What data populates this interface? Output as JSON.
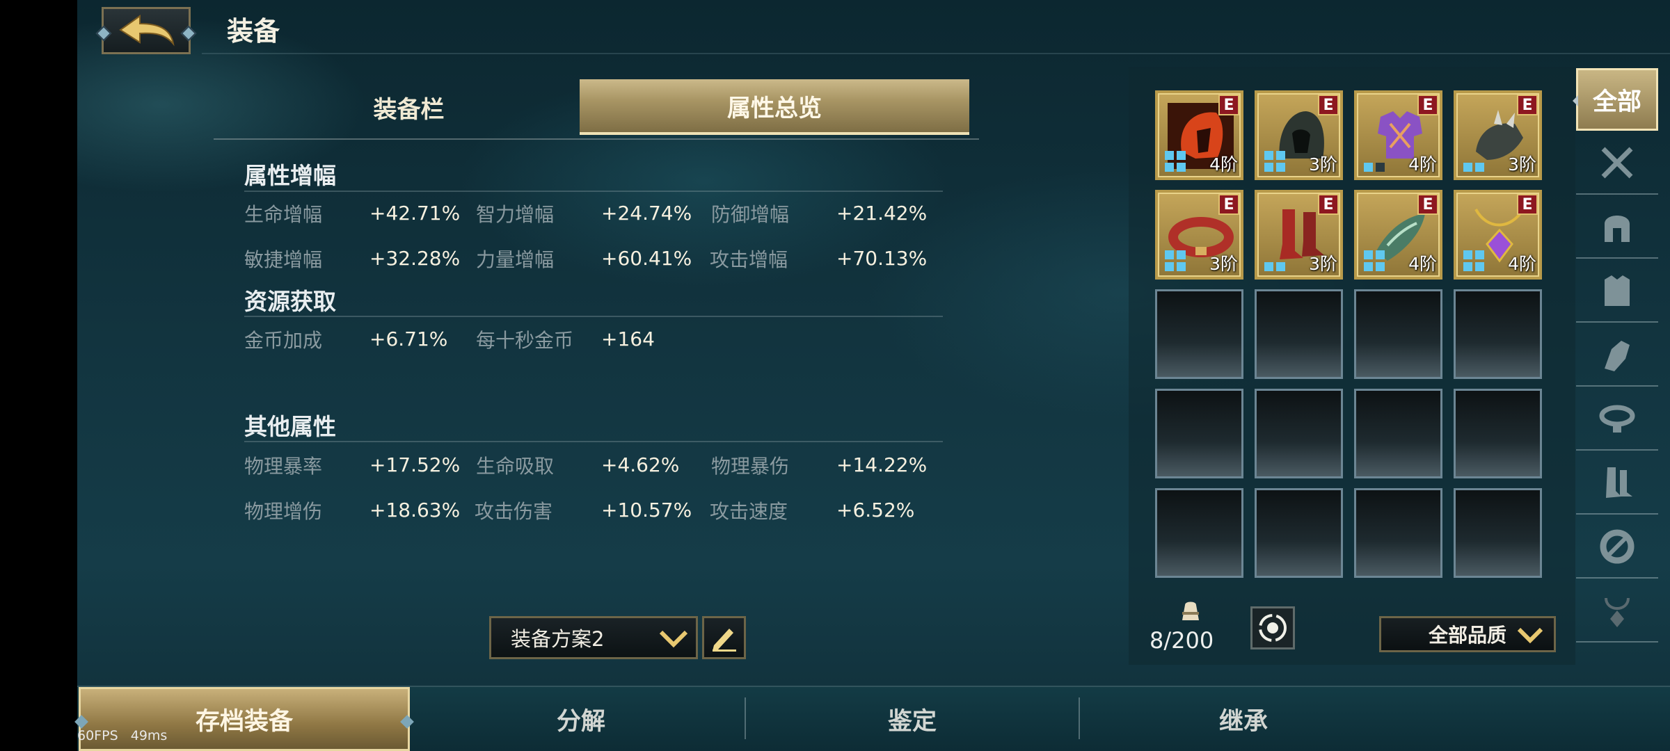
{
  "header": {
    "title": "装备",
    "back_icon": "back-arrow-icon"
  },
  "tabs": {
    "equipment_slots": "装备栏",
    "attribute_overview": "属性总览"
  },
  "sections": {
    "amplify": {
      "title": "属性增幅",
      "rows": [
        [
          {
            "label": "生命增幅",
            "value": "+42.71%"
          },
          {
            "label": "智力增幅",
            "value": "+24.74%"
          },
          {
            "label": "防御增幅",
            "value": "+21.42%"
          }
        ],
        [
          {
            "label": "敏捷增幅",
            "value": "+32.28%"
          },
          {
            "label": "力量增幅",
            "value": "+60.41%"
          },
          {
            "label": "攻击增幅",
            "value": "+70.13%"
          }
        ]
      ]
    },
    "resource": {
      "title": "资源获取",
      "rows": [
        [
          {
            "label": "金币加成",
            "value": "+6.71%"
          },
          {
            "label": "每十秒金币",
            "value": "+164"
          }
        ]
      ]
    },
    "other": {
      "title": "其他属性",
      "rows": [
        [
          {
            "label": "物理暴率",
            "value": "+17.52%"
          },
          {
            "label": "生命吸取",
            "value": "+4.62%"
          },
          {
            "label": "物理暴伤",
            "value": "+14.22%"
          }
        ],
        [
          {
            "label": "物理增伤",
            "value": "+18.63%"
          },
          {
            "label": "攻击伤害",
            "value": "+10.57%"
          },
          {
            "label": "攻击速度",
            "value": "+6.52%"
          }
        ]
      ]
    }
  },
  "loadout": {
    "selected": "装备方案2"
  },
  "inventory": {
    "items": [
      {
        "name": "red-helmet",
        "rank": "E",
        "tier": "4阶"
      },
      {
        "name": "dark-hood",
        "rank": "E",
        "tier": "3阶"
      },
      {
        "name": "purple-armor",
        "rank": "E",
        "tier": "4阶"
      },
      {
        "name": "spiked-gauntlet",
        "rank": "E",
        "tier": "3阶"
      },
      {
        "name": "red-belt",
        "rank": "E",
        "tier": "3阶"
      },
      {
        "name": "red-boots",
        "rank": "E",
        "tier": "3阶"
      },
      {
        "name": "green-bracer",
        "rank": "E",
        "tier": "4阶"
      },
      {
        "name": "purple-amulet",
        "rank": "E",
        "tier": "4阶"
      }
    ],
    "empty_slots": 12,
    "capacity": "8/200",
    "quality_filter": "全部品质"
  },
  "filters": {
    "all_label": "全部",
    "icons": [
      "sword-icon",
      "helmet-icon",
      "armor-icon",
      "gauntlet-icon",
      "belt-icon",
      "boots-icon",
      "bracer-icon",
      "amulet-icon"
    ]
  },
  "bottom_nav": {
    "archive": "存档装备",
    "dismantle": "分解",
    "appraise": "鉴定",
    "inherit": "继承"
  },
  "debug": {
    "fps": "60FPS",
    "latency": "49ms"
  },
  "colors": {
    "gold": "#b89a4a",
    "rank_red": "#8d1820",
    "panel": "#12343f"
  }
}
